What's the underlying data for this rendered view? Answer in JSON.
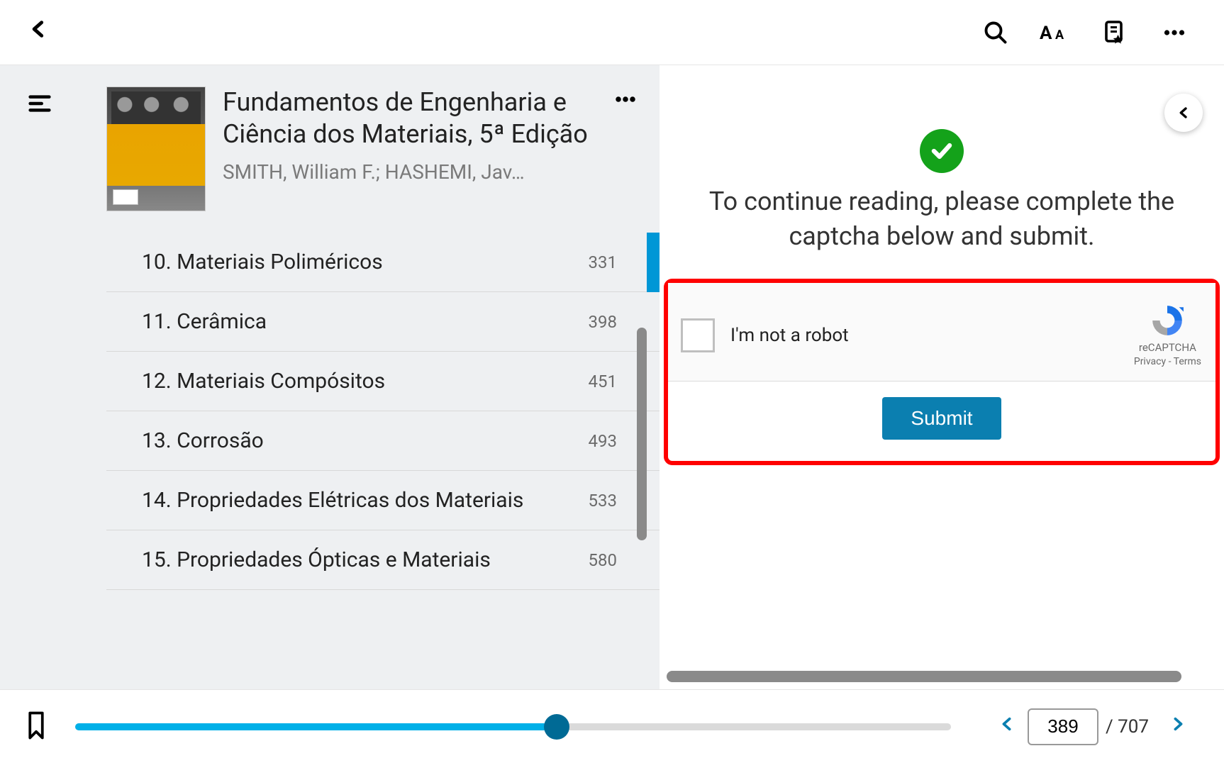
{
  "header": {
    "book_title": "Fundamentos de Engenharia e Ciência dos Materiais, 5ª Edição",
    "book_authors": "SMITH, William F.; HASHEMI, Jav…"
  },
  "toc": {
    "items": [
      {
        "label": "10. Materiais Poliméricos",
        "page": "331",
        "active": true
      },
      {
        "label": "11. Cerâmica",
        "page": "398",
        "active": false
      },
      {
        "label": "12. Materiais Compósitos",
        "page": "451",
        "active": false
      },
      {
        "label": "13. Corrosão",
        "page": "493",
        "active": false
      },
      {
        "label": "14. Propriedades Elétricas dos Materiais",
        "page": "533",
        "active": false
      },
      {
        "label": "15. Propriedades Ópticas e Materiais",
        "page": "580",
        "active": false
      }
    ]
  },
  "captcha": {
    "message": "To continue reading, please complete the captcha below and submit.",
    "checkbox_label": "I'm not a robot",
    "brand": "reCAPTCHA",
    "privacy": "Privacy",
    "terms": "Terms",
    "sep": " - ",
    "submit": "Submit"
  },
  "footer": {
    "current_page": "389",
    "total_pages": "/ 707",
    "progress_percent": 55
  }
}
